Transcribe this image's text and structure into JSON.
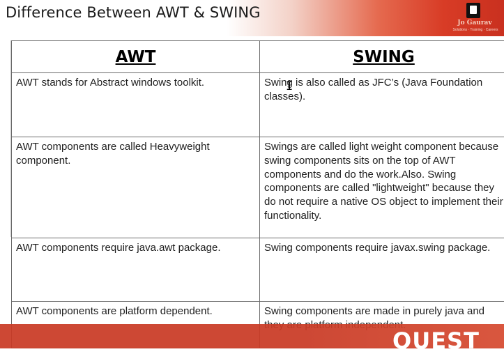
{
  "slide": {
    "title": "Difference Between AWT & SWING",
    "logo_text": "Jo Gaurav",
    "logo_tagline": "Solutions · Training · Careers",
    "footer_logo": "QUEST"
  },
  "table": {
    "headers": [
      "AWT",
      "SWING"
    ],
    "rows": [
      [
        "AWT stands for Abstract windows toolkit.",
        "Swing is also called as JFC’s (Java Foundation classes)."
      ],
      [
        "AWT components are called Heavyweight component.",
        "Swings are called light weight component because swing components sits on the top of AWT components and do the work.Also. Swing components are called \"lightweight\" because they do not require a native OS object to implement their functionality."
      ],
      [
        "AWT components require java.awt package.",
        "Swing components require javax.swing package."
      ],
      [
        "AWT components are platform dependent.",
        "Swing components are made in purely java and they are platform independent."
      ]
    ]
  },
  "colors": {
    "accent_red": "#c93a25",
    "header_gradient_end": "#c9301f",
    "table_border": "#6b6b6b"
  }
}
